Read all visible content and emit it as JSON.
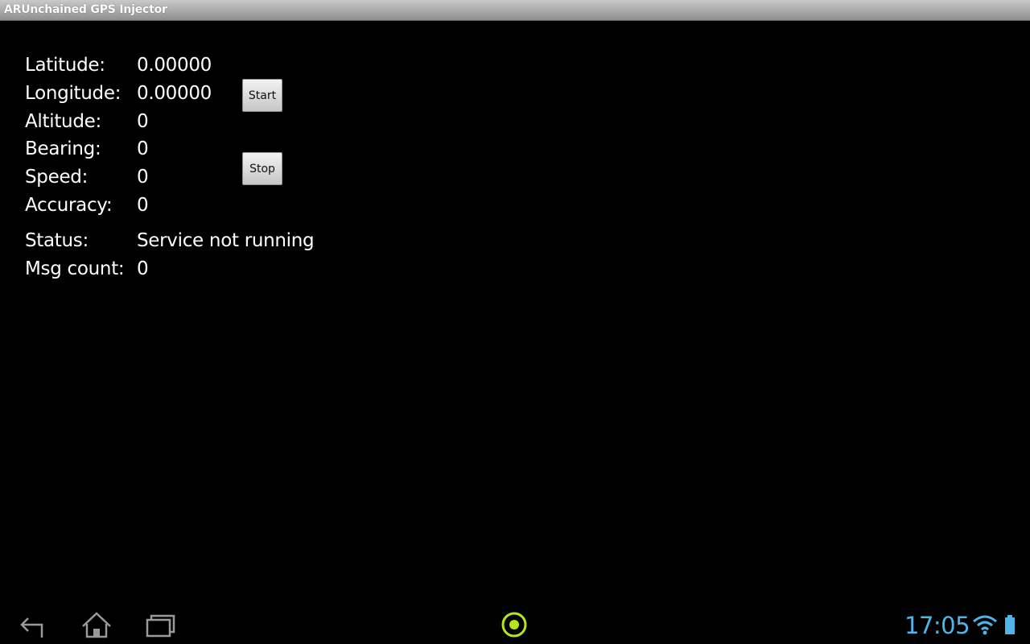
{
  "app": {
    "title": "ARUnchained GPS Injector"
  },
  "fields": [
    {
      "label": "Latitude:",
      "value": "0.00000"
    },
    {
      "label": "Longitude:",
      "value": "0.00000"
    },
    {
      "label": "Altitude:",
      "value": "0"
    },
    {
      "label": "Bearing:",
      "value": "0"
    },
    {
      "label": "Speed:",
      "value": "0"
    },
    {
      "label": "Accuracy:",
      "value": "0"
    }
  ],
  "status": {
    "label": "Status:",
    "value": "Service not running"
  },
  "msg_count": {
    "label": "Msg count:",
    "value": "0"
  },
  "buttons": {
    "start": "Start",
    "stop": "Stop"
  },
  "system_bar": {
    "time": "17:05",
    "icons": [
      "back-icon",
      "home-icon",
      "recent-apps-icon",
      "gps-active-icon",
      "wifi-icon",
      "battery-icon"
    ],
    "clock_color": "#4fb5e8",
    "notification_color": "#b5e61d"
  }
}
